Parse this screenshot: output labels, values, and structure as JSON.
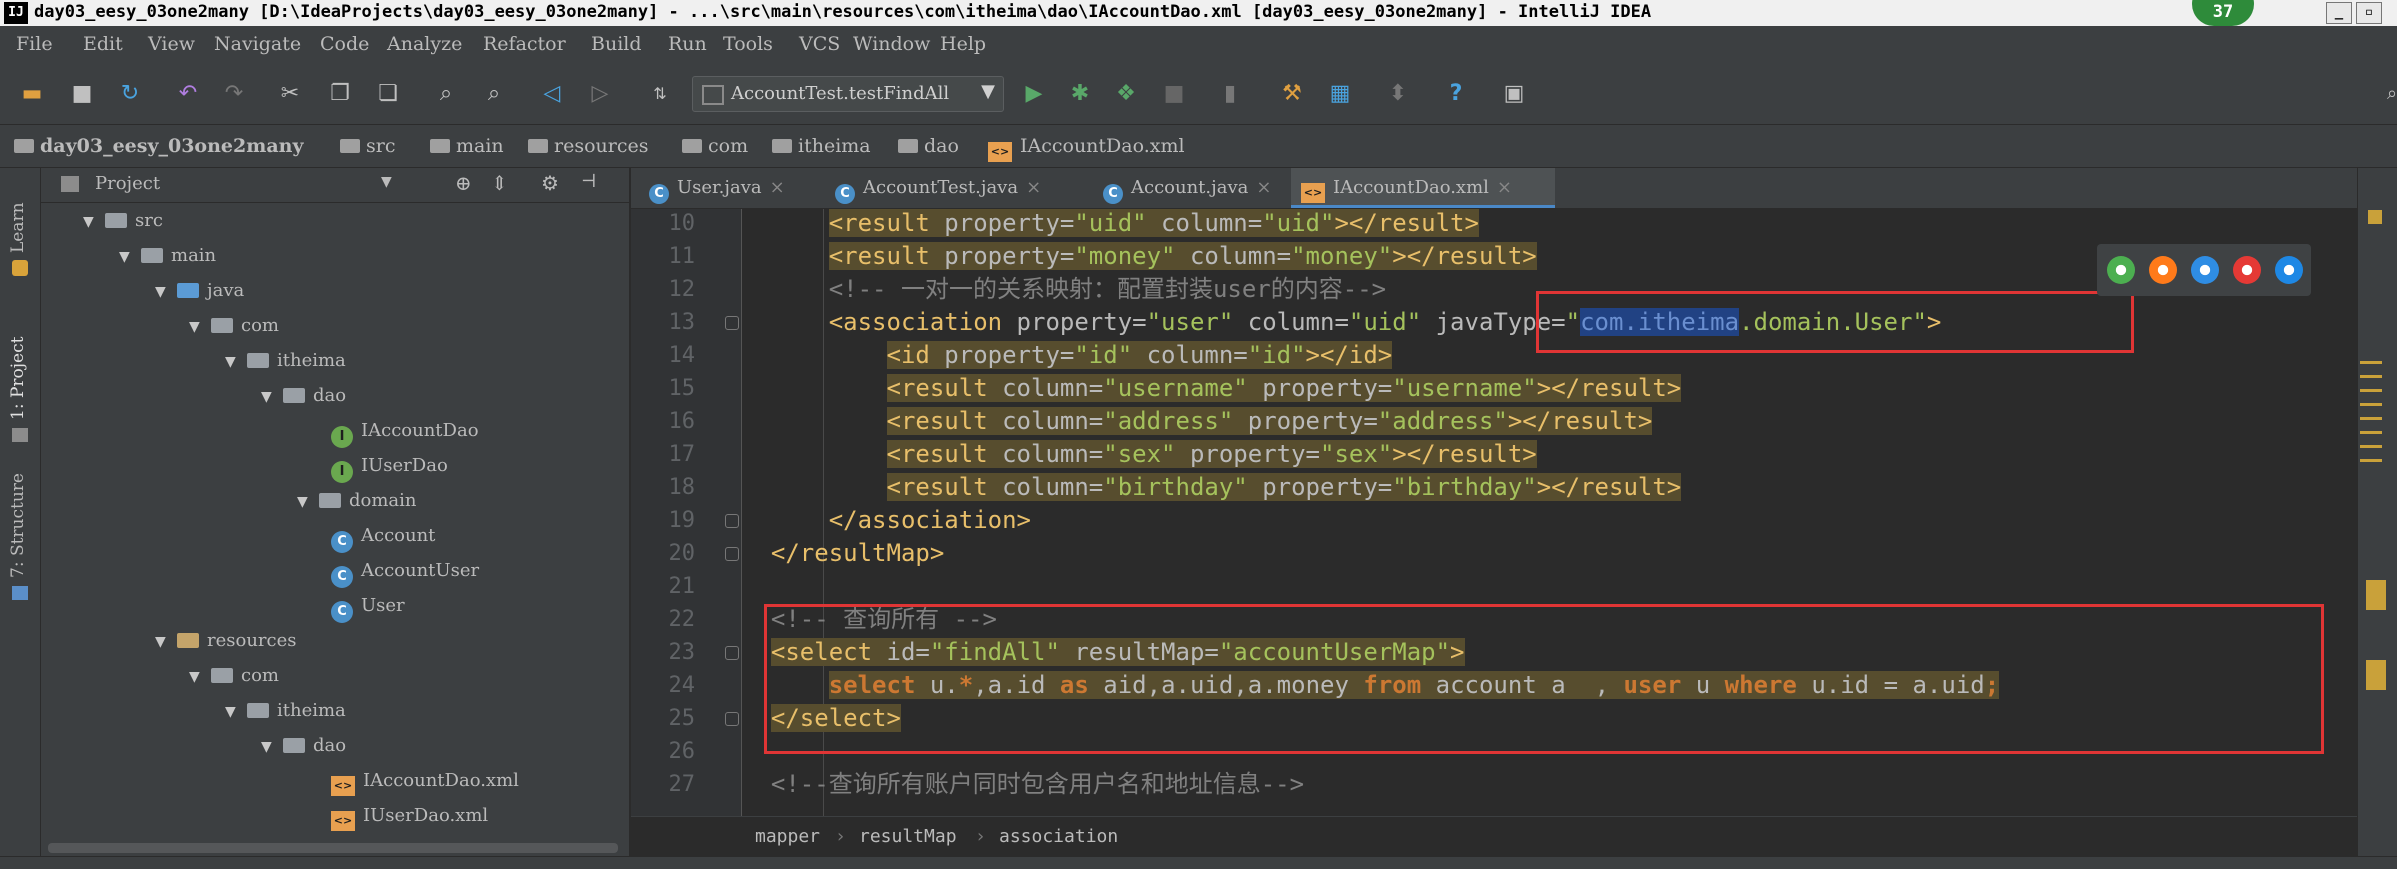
{
  "window": {
    "title": "day03_eesy_03one2many [D:\\IdeaProjects\\day03_eesy_03one2many] - ...\\src\\main\\resources\\com\\itheima\\dao\\IAccountDao.xml [day03_eesy_03one2many] - IntelliJ IDEA",
    "app_icon": "IJ",
    "badge": "37",
    "min_label": "_",
    "max_label": "▫"
  },
  "menu": [
    "File",
    "Edit",
    "View",
    "Navigate",
    "Code",
    "Analyze",
    "Refactor",
    "Build",
    "Run",
    "Tools",
    "VCS",
    "Window",
    "Help"
  ],
  "toolbar": {
    "run_config": "AccountTest.testFindAll",
    "help_glyph": "?"
  },
  "navbar": [
    "day03_eesy_03one2many",
    "src",
    "main",
    "resources",
    "com",
    "itheima",
    "dao",
    "IAccountDao.xml"
  ],
  "tool_windows": {
    "left": [
      "Learn",
      "1: Project",
      "7: Structure"
    ]
  },
  "project_panel": {
    "title": "Project",
    "tree": [
      {
        "label": "src",
        "icon": "folder"
      },
      {
        "label": "main",
        "icon": "folder"
      },
      {
        "label": "java",
        "icon": "folder-source"
      },
      {
        "label": "com",
        "icon": "package"
      },
      {
        "label": "itheima",
        "icon": "package"
      },
      {
        "label": "dao",
        "icon": "package"
      },
      {
        "label": "IAccountDao",
        "icon": "interface",
        "badge": "I"
      },
      {
        "label": "IUserDao",
        "icon": "interface",
        "badge": "I"
      },
      {
        "label": "domain",
        "icon": "package"
      },
      {
        "label": "Account",
        "icon": "class",
        "badge": "C"
      },
      {
        "label": "AccountUser",
        "icon": "class",
        "badge": "C"
      },
      {
        "label": "User",
        "icon": "class",
        "badge": "C"
      },
      {
        "label": "resources",
        "icon": "folder-resources"
      },
      {
        "label": "com",
        "icon": "package"
      },
      {
        "label": "itheima",
        "icon": "package"
      },
      {
        "label": "dao",
        "icon": "package"
      },
      {
        "label": "IAccountDao.xml",
        "icon": "xml-file",
        "badge": "<>"
      },
      {
        "label": "IUserDao.xml",
        "icon": "xml-file",
        "badge": "<>"
      }
    ]
  },
  "tabs": [
    {
      "label": "User.java",
      "badge": "C",
      "active": false
    },
    {
      "label": "AccountTest.java",
      "badge": "C",
      "active": false
    },
    {
      "label": "Account.java",
      "badge": "C",
      "active": false
    },
    {
      "label": "IAccountDao.xml",
      "badge": "<>",
      "active": true
    }
  ],
  "tab_close_glyph": "×",
  "editor": {
    "lines": [
      {
        "n": "10",
        "indent": "      ",
        "segs": [
          [
            "tag",
            "<result "
          ],
          [
            "att",
            "property="
          ],
          [
            "val",
            "\"uid\""
          ],
          [
            "att",
            " column="
          ],
          [
            "val",
            "\"uid\""
          ],
          [
            "tag",
            "></result>"
          ]
        ],
        "hl": true
      },
      {
        "n": "11",
        "indent": "      ",
        "segs": [
          [
            "tag",
            "<result "
          ],
          [
            "att",
            "property="
          ],
          [
            "val",
            "\"money\""
          ],
          [
            "att",
            " column="
          ],
          [
            "val",
            "\"money\""
          ],
          [
            "tag",
            "></result>"
          ]
        ],
        "hl": true
      },
      {
        "n": "12",
        "indent": "      ",
        "segs": [
          [
            "cmt",
            "<!-- 一对一的关系映射：配置封装user的内容-->"
          ]
        ],
        "hl": false
      },
      {
        "n": "13",
        "indent": "      ",
        "segs": [
          [
            "tag",
            "<association "
          ],
          [
            "att",
            "property="
          ],
          [
            "val",
            "\"user\""
          ],
          [
            "att",
            " column="
          ],
          [
            "val",
            "\"uid\""
          ],
          [
            "att",
            " javaType="
          ],
          [
            "val",
            "\""
          ],
          [
            "sel",
            "com.itheima"
          ],
          [
            "val",
            ".domain.User\""
          ],
          [
            "tag",
            ">"
          ]
        ],
        "hl": false
      },
      {
        "n": "14",
        "indent": "          ",
        "segs": [
          [
            "tag",
            "<id "
          ],
          [
            "att",
            "property="
          ],
          [
            "val",
            "\"id\""
          ],
          [
            "att",
            " column="
          ],
          [
            "val",
            "\"id\""
          ],
          [
            "tag",
            "></id>"
          ]
        ],
        "hl": true
      },
      {
        "n": "15",
        "indent": "          ",
        "segs": [
          [
            "tag",
            "<result "
          ],
          [
            "att",
            "column="
          ],
          [
            "val",
            "\"username\""
          ],
          [
            "att",
            " property="
          ],
          [
            "val",
            "\"username\""
          ],
          [
            "tag",
            "></result>"
          ]
        ],
        "hl": true
      },
      {
        "n": "16",
        "indent": "          ",
        "segs": [
          [
            "tag",
            "<result "
          ],
          [
            "att",
            "column="
          ],
          [
            "val",
            "\"address\""
          ],
          [
            "att",
            " property="
          ],
          [
            "val",
            "\"address\""
          ],
          [
            "tag",
            "></result>"
          ]
        ],
        "hl": true
      },
      {
        "n": "17",
        "indent": "          ",
        "segs": [
          [
            "tag",
            "<result "
          ],
          [
            "att",
            "column="
          ],
          [
            "val",
            "\"sex\""
          ],
          [
            "att",
            " property="
          ],
          [
            "val",
            "\"sex\""
          ],
          [
            "tag",
            "></result>"
          ]
        ],
        "hl": true
      },
      {
        "n": "18",
        "indent": "          ",
        "segs": [
          [
            "tag",
            "<result "
          ],
          [
            "att",
            "column="
          ],
          [
            "val",
            "\"birthday\""
          ],
          [
            "att",
            " property="
          ],
          [
            "val",
            "\"birthday\""
          ],
          [
            "tag",
            "></result>"
          ]
        ],
        "hl": true
      },
      {
        "n": "19",
        "indent": "      ",
        "segs": [
          [
            "tag",
            "</association>"
          ]
        ],
        "hl": false
      },
      {
        "n": "20",
        "indent": "  ",
        "segs": [
          [
            "tag",
            "</resultMap>"
          ]
        ],
        "hl": false
      },
      {
        "n": "21",
        "indent": "",
        "segs": [],
        "hl": false
      },
      {
        "n": "22",
        "indent": "  ",
        "segs": [
          [
            "cmt",
            "<!-- 查询所有 -->"
          ]
        ],
        "hl": false
      },
      {
        "n": "23",
        "indent": "  ",
        "segs": [
          [
            "tag",
            "<select "
          ],
          [
            "att",
            "id="
          ],
          [
            "val",
            "\"findAll\""
          ],
          [
            "att",
            " resultMap="
          ],
          [
            "val",
            "\"accountUserMap\""
          ],
          [
            "tag",
            ">"
          ]
        ],
        "hl": true
      },
      {
        "n": "24",
        "indent": "      ",
        "segs": [
          [
            "kw",
            "select "
          ],
          [
            "att",
            "u."
          ],
          [
            "kw",
            "*"
          ],
          [
            "att",
            ",a.id "
          ],
          [
            "kw",
            "as "
          ],
          [
            "att",
            "aid,a.uid,a.money "
          ],
          [
            "kw",
            "from "
          ],
          [
            "att",
            "account a  , "
          ],
          [
            "kw",
            "user "
          ],
          [
            "att",
            "u "
          ],
          [
            "kw",
            "where "
          ],
          [
            "att",
            "u.id = a.uid"
          ],
          [
            "kw",
            ";"
          ]
        ],
        "hl": true
      },
      {
        "n": "25",
        "indent": "  ",
        "segs": [
          [
            "tag",
            "</select>"
          ]
        ],
        "hl": true
      },
      {
        "n": "26",
        "indent": "",
        "segs": [],
        "hl": false
      },
      {
        "n": "27",
        "indent": "  ",
        "segs": [
          [
            "cmt",
            "<!--查询所有账户同时包含用户名和地址信息-->"
          ]
        ],
        "hl": false
      }
    ]
  },
  "breadcrumbs": [
    "mapper",
    "resultMap",
    "association"
  ],
  "browser_icons": [
    {
      "name": "chrome",
      "color": "#4caf50"
    },
    {
      "name": "firefox",
      "color": "#ff7a1a"
    },
    {
      "name": "safari",
      "color": "#2f8de4"
    },
    {
      "name": "opera",
      "color": "#e53935"
    },
    {
      "name": "ie",
      "color": "#1e88e5"
    }
  ],
  "colors": {
    "highlight": "#574d2e",
    "tag": "#e8bf6a",
    "value": "#a5c25c",
    "keyword": "#cc7832",
    "annotation": "#e03535"
  }
}
